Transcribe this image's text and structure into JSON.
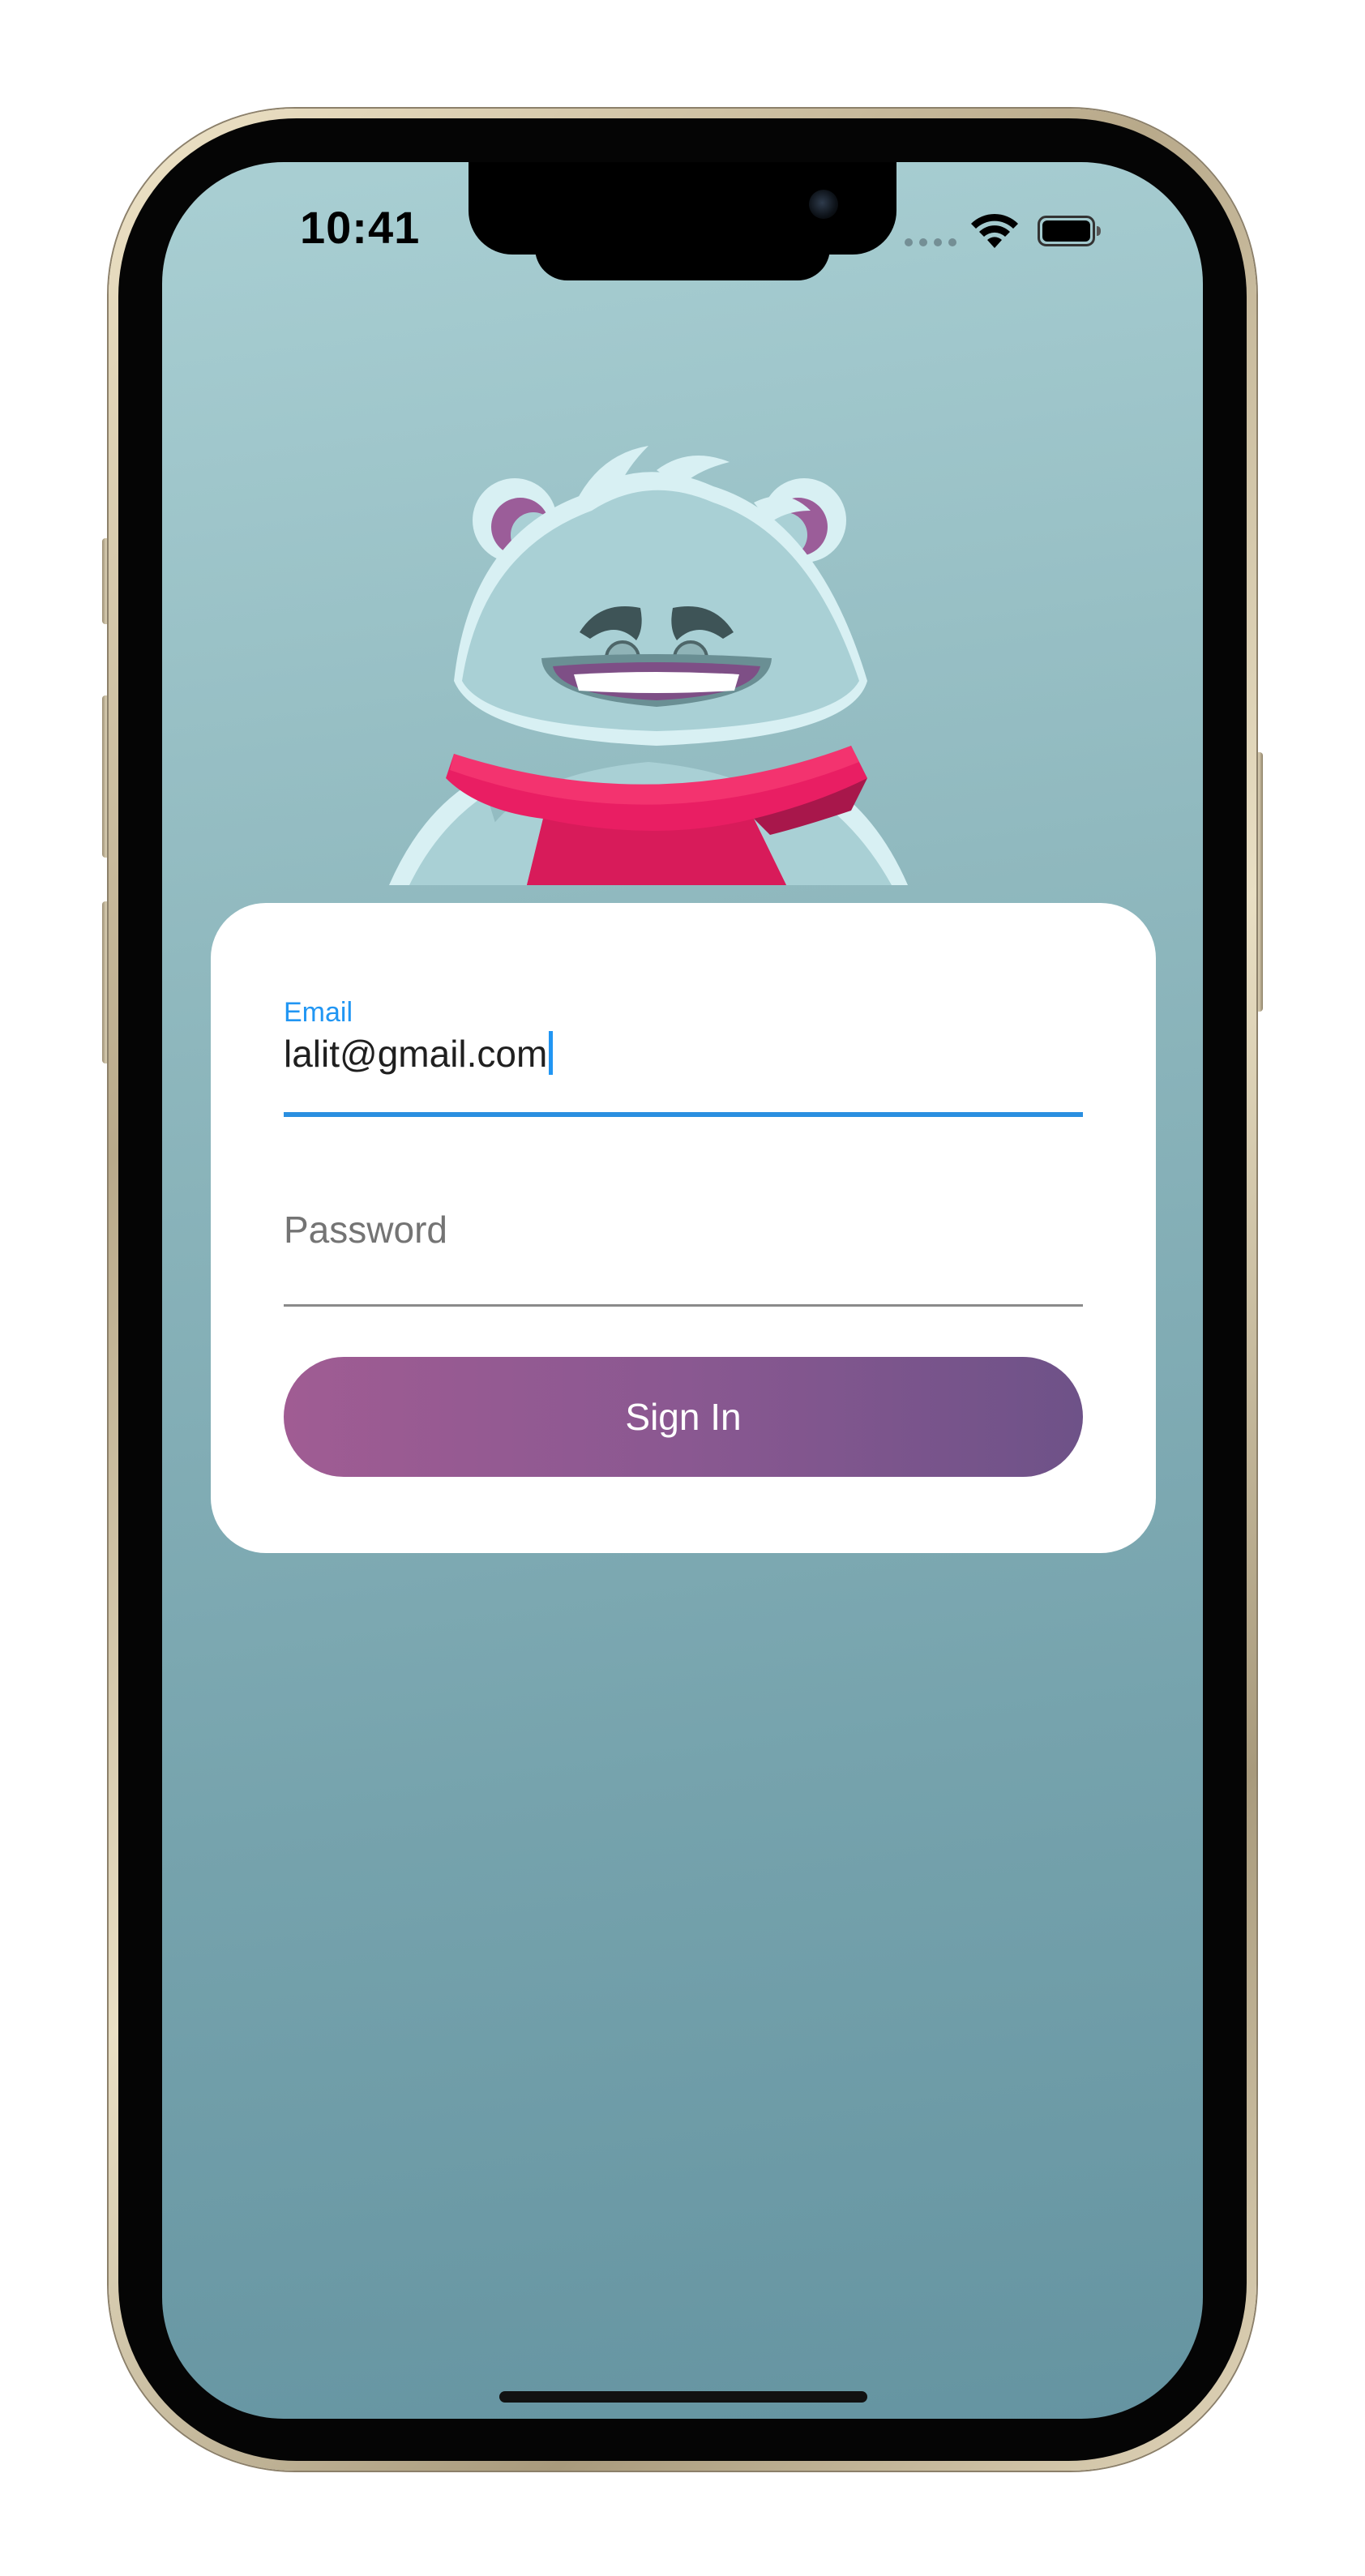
{
  "status_bar": {
    "time": "10:41"
  },
  "login_form": {
    "email": {
      "label": "Email",
      "value": "lalit@gmail.com"
    },
    "password": {
      "placeholder": "Password"
    },
    "sign_in_label": "Sign In"
  },
  "colors": {
    "accent": "#2196f3",
    "button_gradient_start": "#a05c93",
    "button_gradient_end": "#6e5288",
    "background_top": "#a9cfd3",
    "background_bottom": "#6594a1"
  },
  "icons": {
    "wifi": "wifi-icon",
    "battery": "battery-icon",
    "signal": "cellular-signal-icon",
    "mascot": "yeti-mascot"
  }
}
